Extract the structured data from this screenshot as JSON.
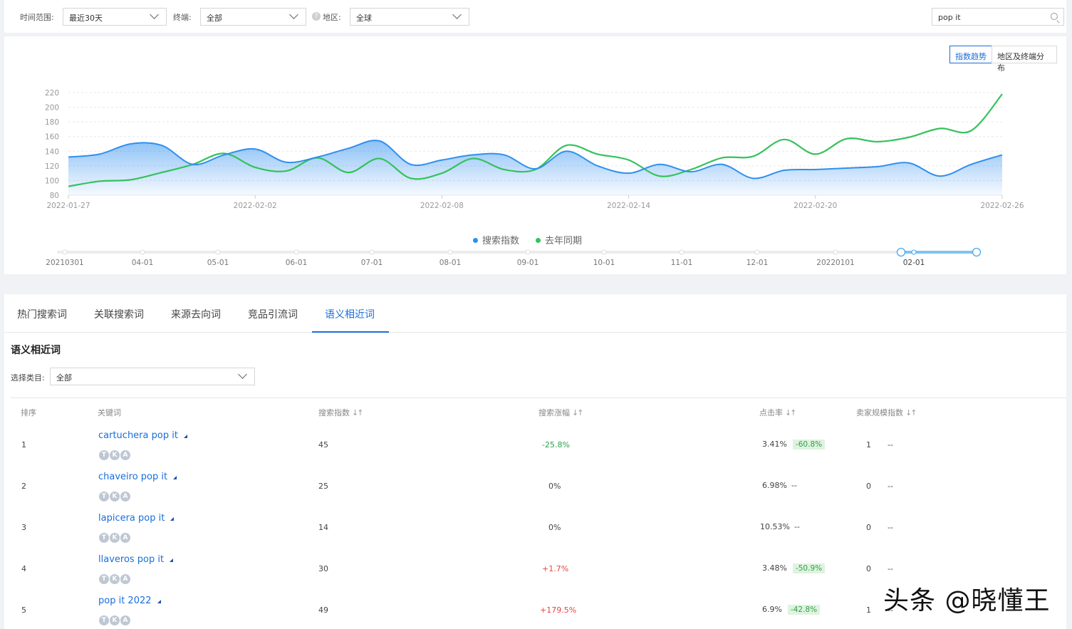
{
  "filters": {
    "time_label": "时间范围:",
    "time_value": "最近30天",
    "device_label": "终端:",
    "device_value": "全部",
    "region_label": "地区:",
    "region_value": "全球",
    "help_glyph": "?",
    "search_value": "pop it"
  },
  "view_toggle": {
    "trend": "指数趋势",
    "distribution": "地区及终端分布"
  },
  "chart_data": {
    "type": "area",
    "x": [
      "2022-01-27",
      "2022-01-28",
      "2022-01-29",
      "2022-01-30",
      "2022-01-31",
      "2022-02-01",
      "2022-02-02",
      "2022-02-03",
      "2022-02-04",
      "2022-02-05",
      "2022-02-06",
      "2022-02-07",
      "2022-02-08",
      "2022-02-09",
      "2022-02-10",
      "2022-02-11",
      "2022-02-12",
      "2022-02-13",
      "2022-02-14",
      "2022-02-15",
      "2022-02-16",
      "2022-02-17",
      "2022-02-18",
      "2022-02-19",
      "2022-02-20",
      "2022-02-21",
      "2022-02-22",
      "2022-02-23",
      "2022-02-24",
      "2022-02-25",
      "2022-02-26"
    ],
    "xticks": [
      "2022-01-27",
      "2022-02-02",
      "2022-02-08",
      "2022-02-14",
      "2022-02-20",
      "2022-02-26"
    ],
    "yticks": [
      80,
      100,
      120,
      140,
      160,
      180,
      200,
      220
    ],
    "ylim": [
      80,
      220
    ],
    "series": [
      {
        "name": "搜索指数",
        "color": "#2f8ff0",
        "values": [
          132,
          136,
          150,
          148,
          122,
          135,
          143,
          125,
          132,
          144,
          154,
          122,
          128,
          135,
          135,
          116,
          140,
          120,
          110,
          122,
          112,
          122,
          103,
          114,
          115,
          117,
          119,
          124,
          106,
          122,
          135
        ]
      },
      {
        "name": "去年同期",
        "color": "#34c25b",
        "values": [
          92,
          99,
          101,
          111,
          122,
          137,
          118,
          113,
          131,
          111,
          130,
          103,
          110,
          130,
          115,
          115,
          148,
          136,
          128,
          106,
          115,
          131,
          133,
          156,
          136,
          157,
          153,
          159,
          171,
          168,
          218
        ]
      }
    ]
  },
  "slider": {
    "labels": [
      "20210301",
      "04-01",
      "05-01",
      "06-01",
      "07-01",
      "08-01",
      "09-01",
      "10-01",
      "11-01",
      "12-01",
      "20220101",
      "02-01"
    ]
  },
  "tabs": [
    "热门搜索词",
    "关联搜索词",
    "来源去向词",
    "竞品引流词",
    "语义相近词"
  ],
  "section": {
    "title": "语义相近词",
    "category_label": "选择类目:",
    "category_value": "全部"
  },
  "table": {
    "headers": {
      "rank": "排序",
      "keyword": "关键词",
      "search_index": "搜索指数",
      "search_growth": "搜索涨幅",
      "ctr": "点击率",
      "seller_index": "卖家规模指数",
      "sort_glyph": "↓↑"
    },
    "badges": [
      "T",
      "K",
      "A"
    ],
    "rows": [
      {
        "rank": "1",
        "keyword": "cartuchera pop it",
        "search_index": "45",
        "growth": "-25.8%",
        "growth_type": "neg",
        "ctr": "3.41%",
        "ctr_change": "-60.8%",
        "seller": "1",
        "seller_change": "--"
      },
      {
        "rank": "2",
        "keyword": "chaveiro pop it",
        "search_index": "25",
        "growth": "0%",
        "growth_type": "zero",
        "ctr": "6.98%",
        "ctr_change": "--",
        "seller": "0",
        "seller_change": "--"
      },
      {
        "rank": "3",
        "keyword": "lapicera pop it",
        "search_index": "14",
        "growth": "0%",
        "growth_type": "zero",
        "ctr": "10.53%",
        "ctr_change": "--",
        "seller": "0",
        "seller_change": "--"
      },
      {
        "rank": "4",
        "keyword": "llaveros pop it",
        "search_index": "30",
        "growth": "+1.7%",
        "growth_type": "pos",
        "ctr": "3.48%",
        "ctr_change": "-50.9%",
        "seller": "0",
        "seller_change": "--"
      },
      {
        "rank": "5",
        "keyword": "pop it 2022",
        "search_index": "49",
        "growth": "+179.5%",
        "growth_type": "pos",
        "ctr": "6.9%",
        "ctr_change": "-42.8%",
        "seller": "1",
        "seller_change": "--"
      }
    ]
  },
  "watermark": "头条 @晓懂王"
}
